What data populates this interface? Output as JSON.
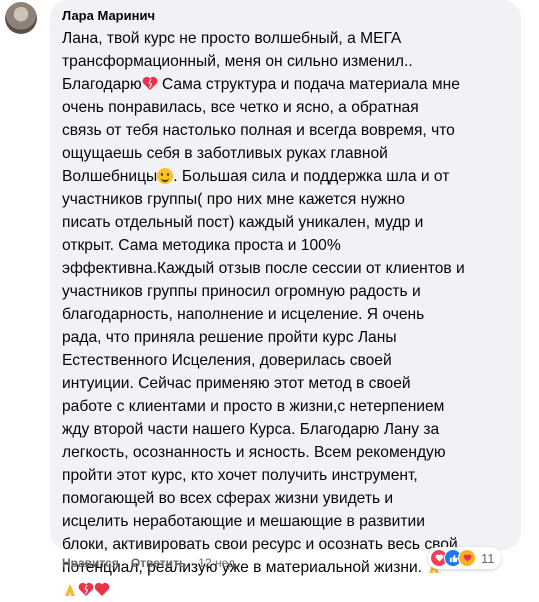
{
  "comment": {
    "author": "Лара Маринич",
    "lines": [
      "Лана, твой курс не просто волшебный, а МЕГА",
      "трансформационный, меня он сильно изменил..",
      "Сама структура и подача материала мне",
      "очень понравилась, все четко и ясно, а обратная",
      "связь от тебя настолько полная и всегда вовремя, что",
      "ощущаешь себя в заботливых руках главной",
      ". Большая сила и поддержка шла и от",
      "участников группы( про них мне кажется нужно",
      "писать отдельный пост) каждый уникален, мудр и",
      "открыт. Сама методика проста и 100%",
      "эффективна.Каждый отзыв после сессии от клиентов и",
      "участников группы приносил огромную радость и",
      "благодарность, наполнение и исцеление. Я очень",
      "рада, что приняла решение пройти курс Ланы",
      "Естественного Исцеления, доверилась своей",
      "интуиции. Сейчас применяю этот метод в своей",
      "работе с клиентами и просто в жизни,с нетерпением",
      "жду второй части нашего Курса. Благодарю Лану за",
      "легкость, осознанность и ясность. Всем рекомендую",
      "пройти этот курс, кто хочет получить инструмент,",
      "помогающей во всех сферах жизни увидеть и",
      "исцелить неработающие и мешающие в развитии",
      "блоки, активировать свои ресурс и осознать весь свой",
      "потенциал, реализую уже в материальной жизни."
    ],
    "line3_prefix": "Благодарю",
    "line7_prefix": "Волшебницы"
  },
  "reactions": {
    "count": "11"
  },
  "actions": {
    "like": "Нравится",
    "reply": "Ответить",
    "time": "12 нед."
  },
  "colors": {
    "bubble": "#f0f2f5",
    "meta": "#65676b",
    "text": "#050505"
  }
}
